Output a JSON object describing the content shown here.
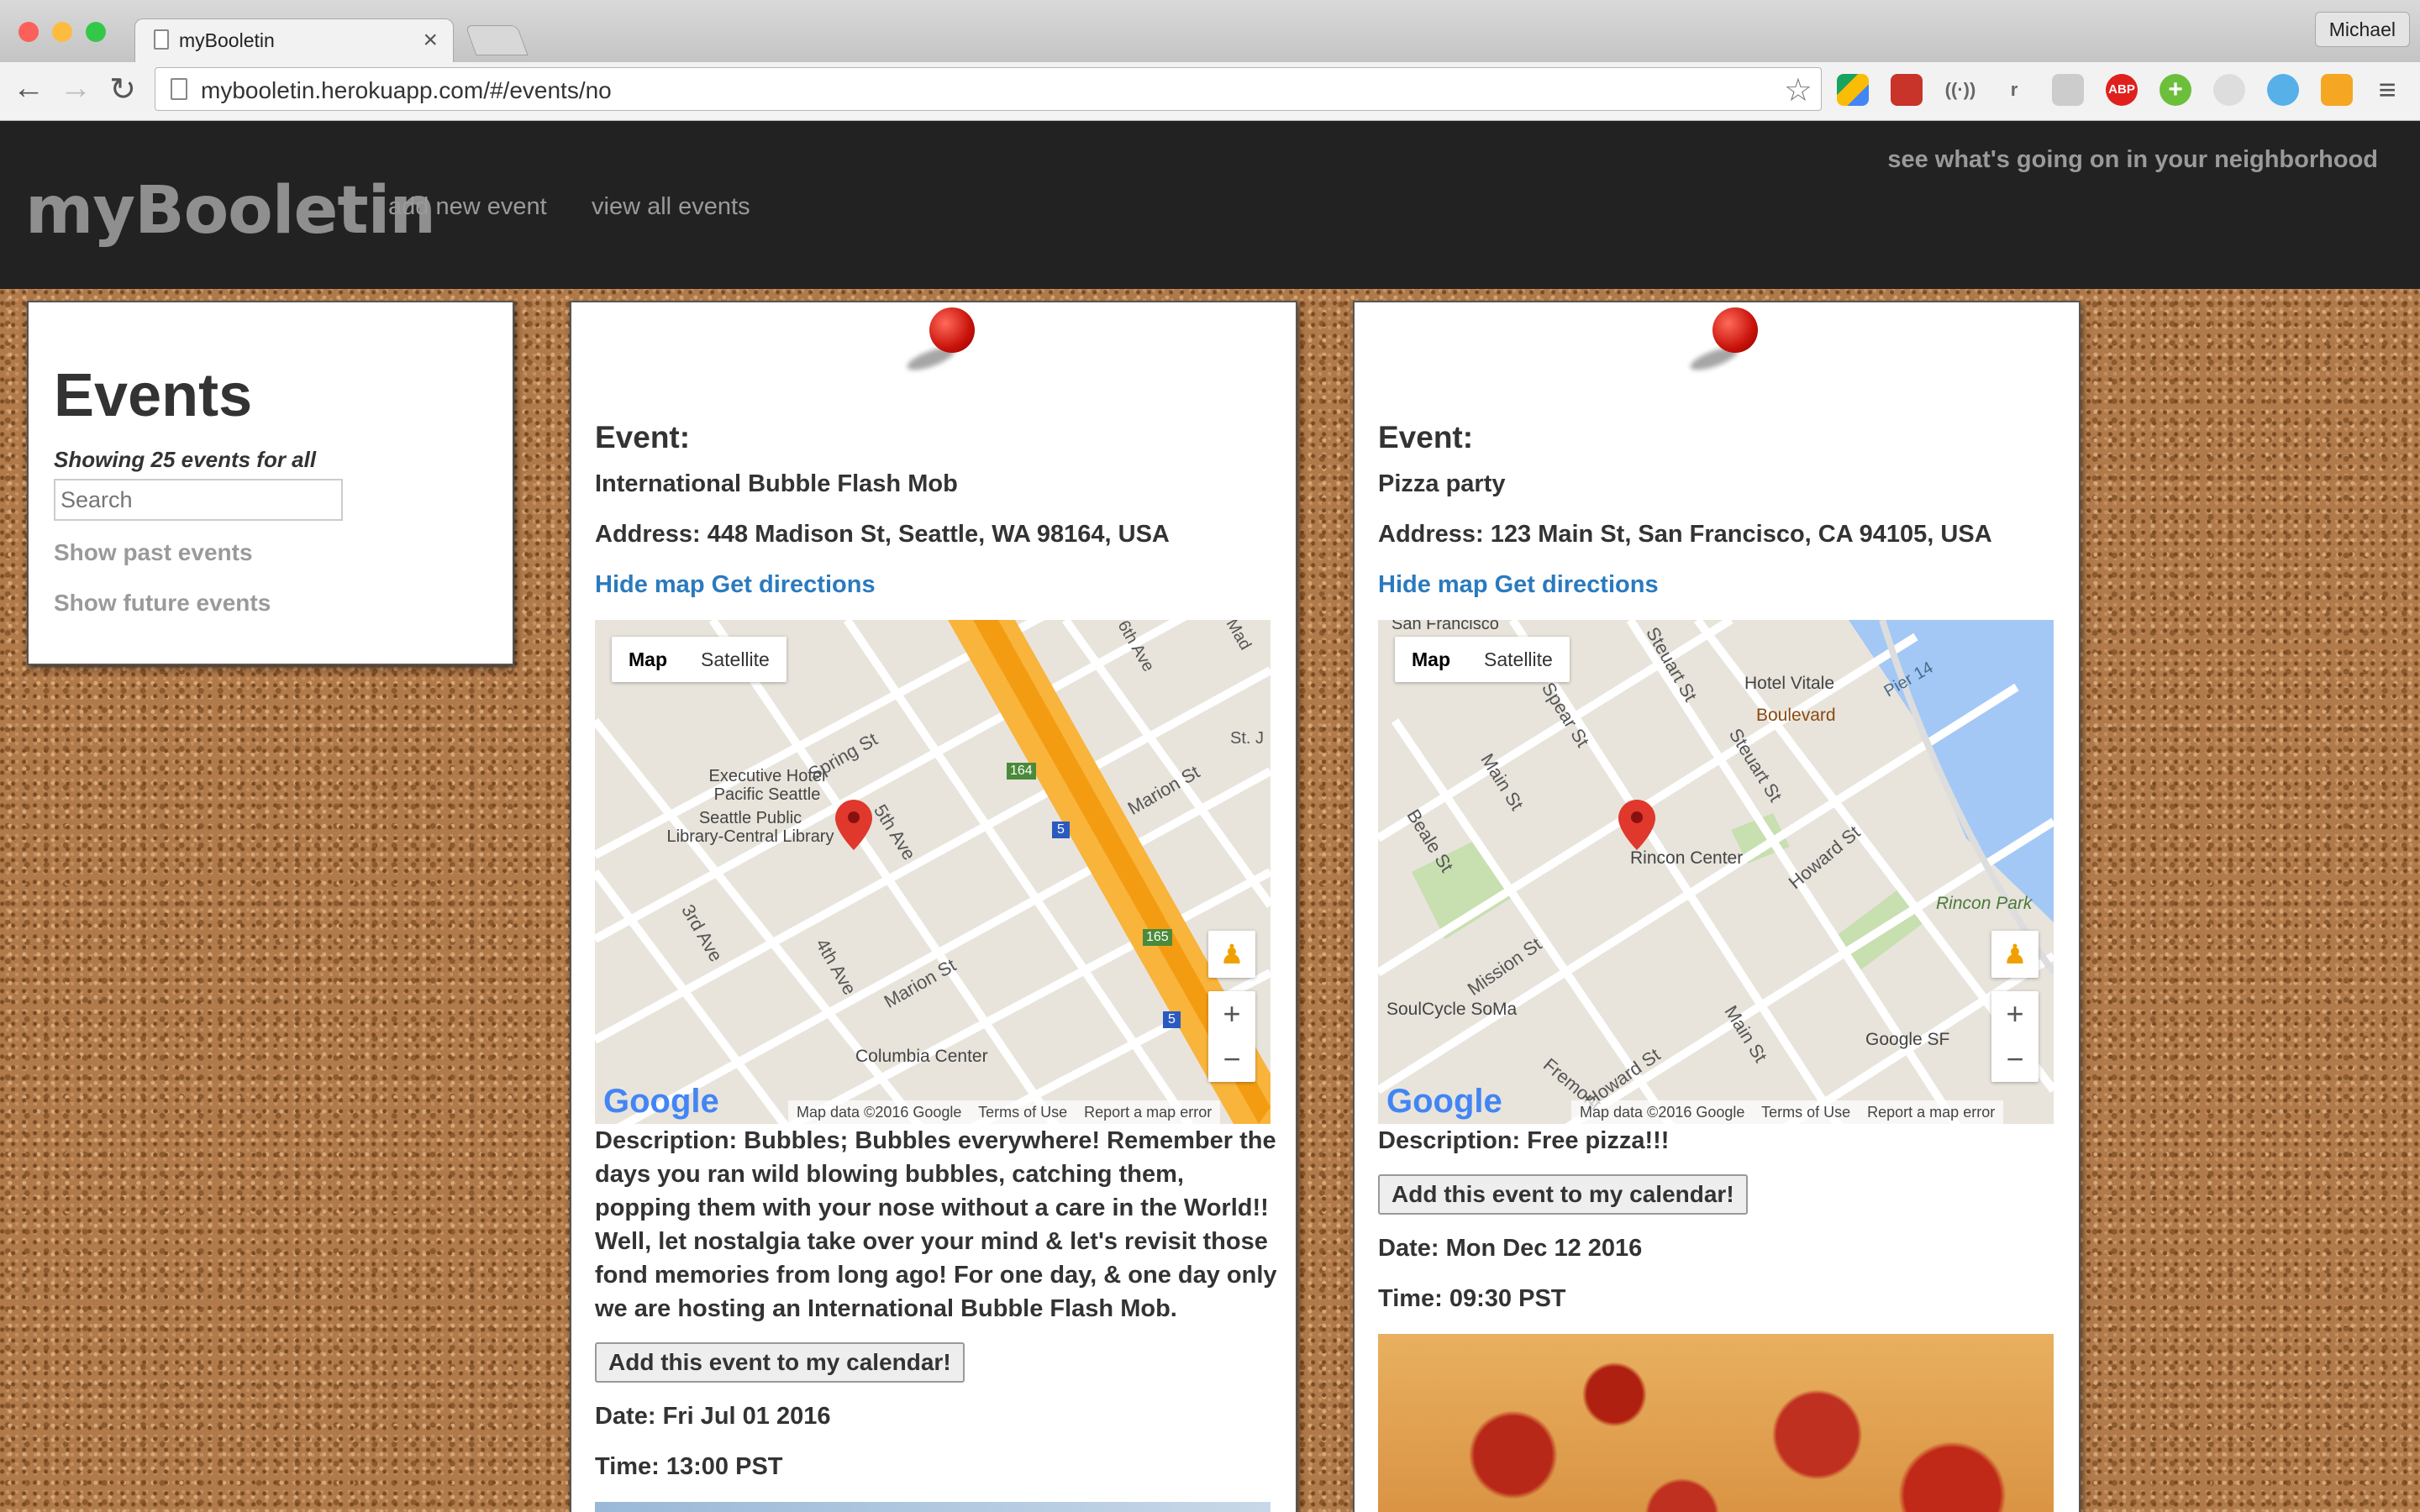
{
  "browser": {
    "tab_title": "myBooletin",
    "tab_close": "×",
    "profile_name": "Michael",
    "url": "mybooletin.herokuapp.com/#/events/no",
    "back": "←",
    "forward": "→",
    "reload": "↻",
    "star": "☆",
    "extensions": [
      "google-drive-icon",
      "bookmark-icon",
      "wifi-icon",
      "r-icon",
      "cloud-icon",
      "adblock-plus-icon",
      "add-icon",
      "circle-icon",
      "feedly-icon",
      "keeper-icon",
      "menu-icon"
    ],
    "ext_abp": "ABP",
    "ext_r": "r",
    "menu": "≡"
  },
  "site": {
    "brand": "myBooletin",
    "nav": [
      "add new event",
      "view all events"
    ],
    "tagline": "see what's going on in your neighborhood"
  },
  "sidebar": {
    "title": "Events",
    "showing": "Showing 25 events for all",
    "search_placeholder": "Search",
    "options": [
      "Show past events",
      "Show future events"
    ]
  },
  "events": [
    {
      "label": "Event:",
      "name": "International Bubble Flash Mob",
      "address": "Address: 448 Madison St, Seattle, WA 98164, USA",
      "hide_map": "Hide map",
      "directions": "Get directions",
      "description": "Description: Bubbles; Bubbles everywhere! Remember the days you ran wild blowing bubbles, catching them, popping them with your nose without a care in the World!! Well, let nostalgia take over your mind & let's revisit those fond memories from long ago! For one day, & one day only we are hosting an International Bubble Flash Mob.",
      "calendar_button": "Add this event to my calendar!",
      "date": "Date: Fri Jul 01 2016",
      "time": "Time: 13:00 PST",
      "map": {
        "type_map": "Map",
        "type_satellite": "Satellite",
        "labels": [
          "Executive Hotel",
          "Pacific Seattle",
          "Seattle Public",
          "Library-Central Library",
          "Spring St",
          "5th Ave",
          "Marion St",
          "3rd Ave",
          "4th Ave",
          "Marion St",
          "Columbia Center",
          "164",
          "165",
          "5",
          "5",
          "St. J",
          "6th Ave",
          "Mad"
        ],
        "footer_data": "Map data ©2016 Google",
        "footer_terms": "Terms of Use",
        "footer_report": "Report a map error",
        "zoom_in": "+",
        "zoom_out": "−",
        "logo": "Google"
      }
    },
    {
      "label": "Event:",
      "name": "Pizza party",
      "address": "Address: 123 Main St, San Francisco, CA 94105, USA",
      "hide_map": "Hide map",
      "directions": "Get directions",
      "description": "Description: Free pizza!!!",
      "calendar_button": "Add this event to my calendar!",
      "date": "Date: Mon Dec 12 2016",
      "time": "Time: 09:30 PST",
      "map": {
        "type_map": "Map",
        "type_satellite": "Satellite",
        "labels": [
          "San Francisco",
          "Steuart St",
          "Hotel Vitale",
          "Pier 14",
          "Boulevard",
          "Spear St",
          "Main St",
          "Steuart St",
          "Rincon Center",
          "Howard St",
          "Rincon Park",
          "Beale St",
          "Mission St",
          "SoulCycle SoMa",
          "Main St",
          "Google SF",
          "Howard St",
          "Fremont"
        ],
        "footer_data": "Map data ©2016 Google",
        "footer_terms": "Terms of Use",
        "footer_report": "Report a map error",
        "zoom_in": "+",
        "zoom_out": "−",
        "logo": "Google"
      }
    }
  ],
  "colors": {
    "link": "#2a7abf",
    "header_bg": "#222222",
    "marker": "#e0382c"
  }
}
